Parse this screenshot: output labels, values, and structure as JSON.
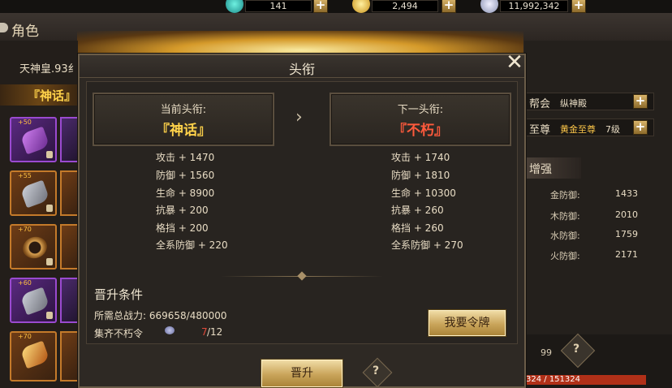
{
  "colors": {
    "gold_title": "#ffd24a",
    "red_title": "#ff5a3c",
    "warn_red": "#e04a3a",
    "panel_dark": "#2e2924"
  },
  "resources": [
    {
      "icon": "jade-swirl-icon",
      "value": "141"
    },
    {
      "icon": "gold-coin-icon",
      "value": "2,494"
    },
    {
      "icon": "silver-coin-icon",
      "value": "11,992,342"
    }
  ],
  "screen": {
    "title": "角色",
    "char_name": "天神皇.93纟",
    "current_title_short": "『神话』",
    "equipment_levels": [
      "+50",
      "+55",
      "+70",
      "+60",
      "+70"
    ]
  },
  "right_panel": {
    "guild_label": "帮会",
    "guild_value": "纵神殿",
    "supreme_label": "至尊",
    "supreme_value": "黄金至尊",
    "supreme_level": "7级",
    "enhance_label": "增强",
    "elements": [
      {
        "label": "金防御:",
        "value": "1433"
      },
      {
        "label": "木防御:",
        "value": "2010"
      },
      {
        "label": "水防御:",
        "value": "1759"
      },
      {
        "label": "火防御:",
        "value": "2171"
      }
    ],
    "bottom_num": "99",
    "hp_text": "324 / 151324"
  },
  "modal": {
    "title": "头衔",
    "close_icon": "close-icon",
    "current": {
      "label": "当前头衔:",
      "name": "『神话』",
      "stats": [
        "攻击 + 1470",
        "防御 + 1560",
        "生命 + 8900",
        "抗暴 + 200",
        "格挡 + 200",
        "全系防御 + 220"
      ]
    },
    "next": {
      "label": "下一头衔:",
      "name": "『不朽』",
      "stats": [
        "攻击 + 1740",
        "防御 + 1810",
        "生命 + 10300",
        "抗暴 + 260",
        "格挡 + 260",
        "全系防御 + 270"
      ]
    },
    "conditions": {
      "title": "晋升条件",
      "power_line": "所需总战力: 669658/480000",
      "token_label": "集齐不朽令",
      "token_have": "7",
      "token_need": "/12"
    },
    "get_token_button": "我要令牌",
    "promote_button": "晋升",
    "help_icon": "?"
  }
}
